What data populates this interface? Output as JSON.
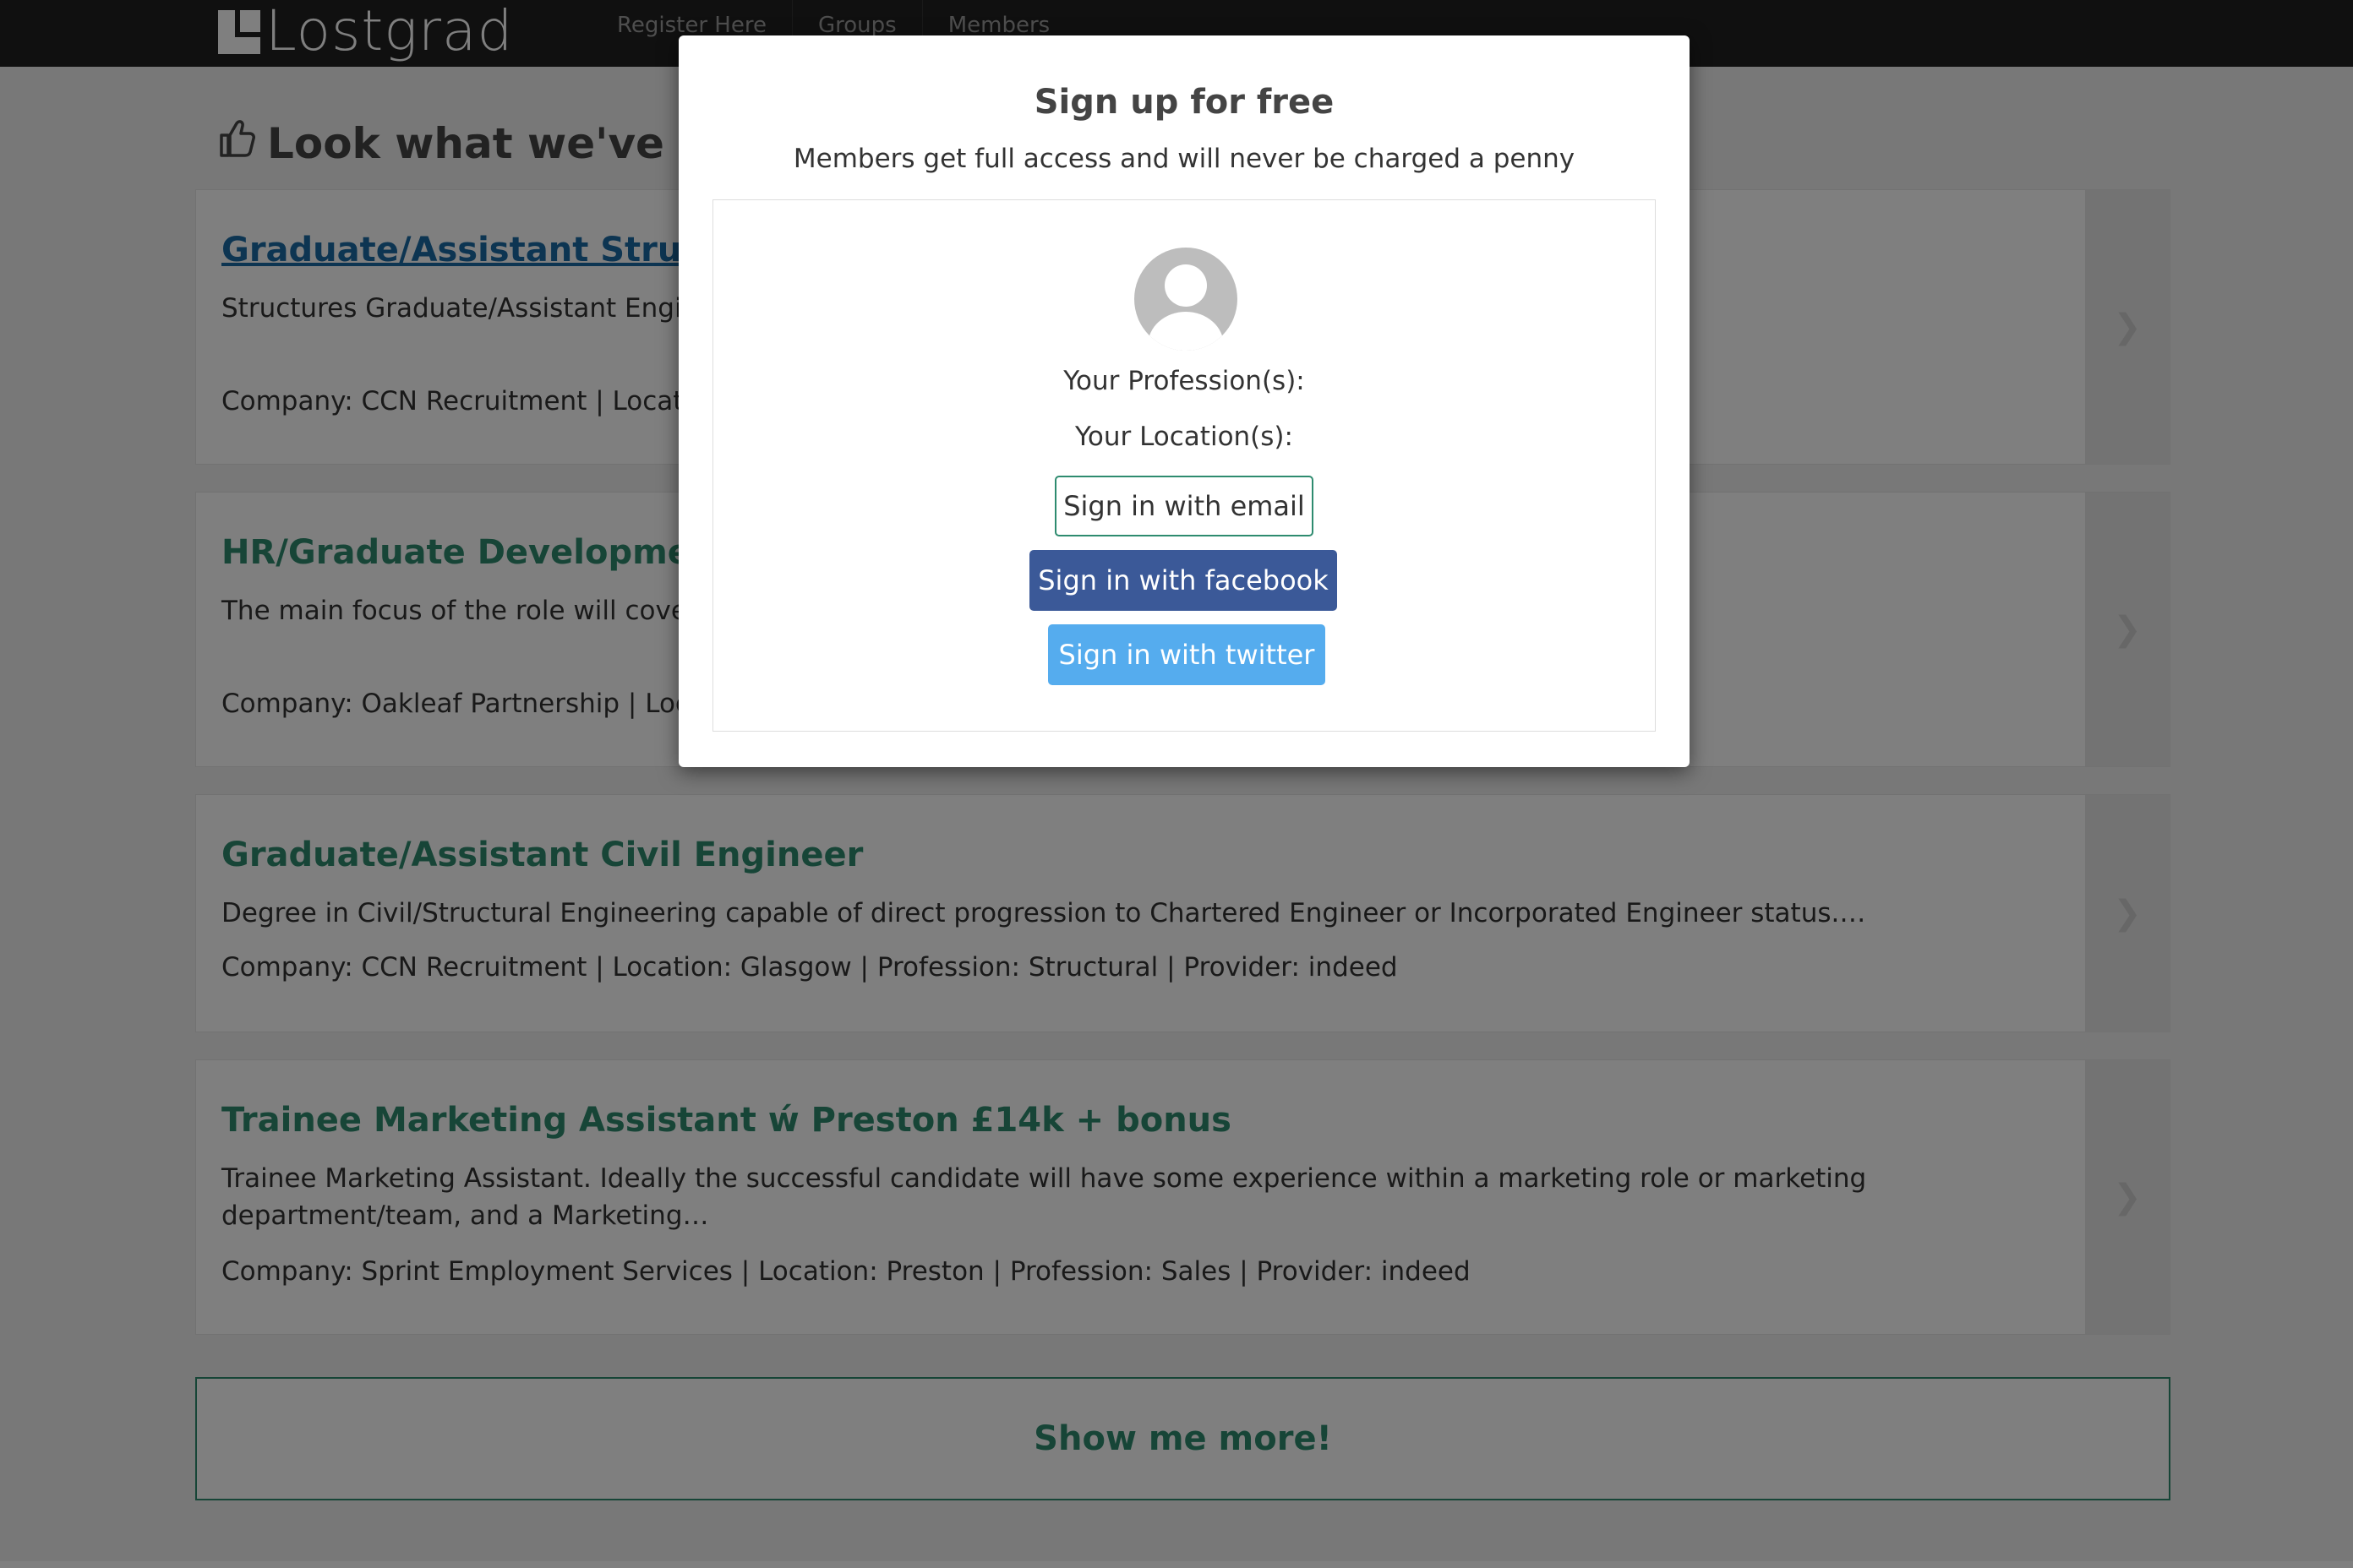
{
  "navbar": {
    "logo_text": "Lostgrad",
    "links": [
      "Register Here",
      "Groups",
      "Members"
    ]
  },
  "main": {
    "heading": "Look what we've found",
    "jobs": [
      {
        "title": "Graduate/Assistant Structures Engineer",
        "description": "Structures Graduate/Assistant Engineer ... progression to Chartered Engineer or…",
        "meta": "Company: CCN Recruitment | Location"
      },
      {
        "title": "HR/Graduate Development Advisor",
        "description": "The main focus of the role will cover T... nal secondments, Trainee performance…",
        "meta": "Company: Oakleaf Partnership | Location"
      },
      {
        "title": "Graduate/Assistant Civil Engineer",
        "description": "Degree in Civil/Structural Engineering capable of direct progression to Chartered Engineer or Incorporated Engineer status.…",
        "meta": "Company: CCN Recruitment | Location: Glasgow | Profession: Structural | Provider: indeed"
      },
      {
        "title": "Trainee Marketing Assistant ẃ Preston £14k + bonus",
        "description": "Trainee Marketing Assistant. Ideally the successful candidate will have some experience within a marketing role or marketing department/team, and a Marketing…",
        "meta": "Company: Sprint Employment Services | Location: Preston | Profession: Sales | Provider: indeed"
      }
    ],
    "more_label": "Show me more!"
  },
  "modal": {
    "title": "Sign up for free",
    "subtitle": "Members get full access and will never be charged a penny",
    "profession_label": "Your Profession(s):",
    "location_label": "Your Location(s):",
    "email_button": "Sign in with email",
    "facebook_button": "Sign in with facebook",
    "twitter_button": "Sign in with twitter"
  },
  "colors": {
    "accent": "#2e8b6f",
    "facebook": "#3b5998",
    "twitter": "#55acee",
    "navbar": "#212121"
  }
}
